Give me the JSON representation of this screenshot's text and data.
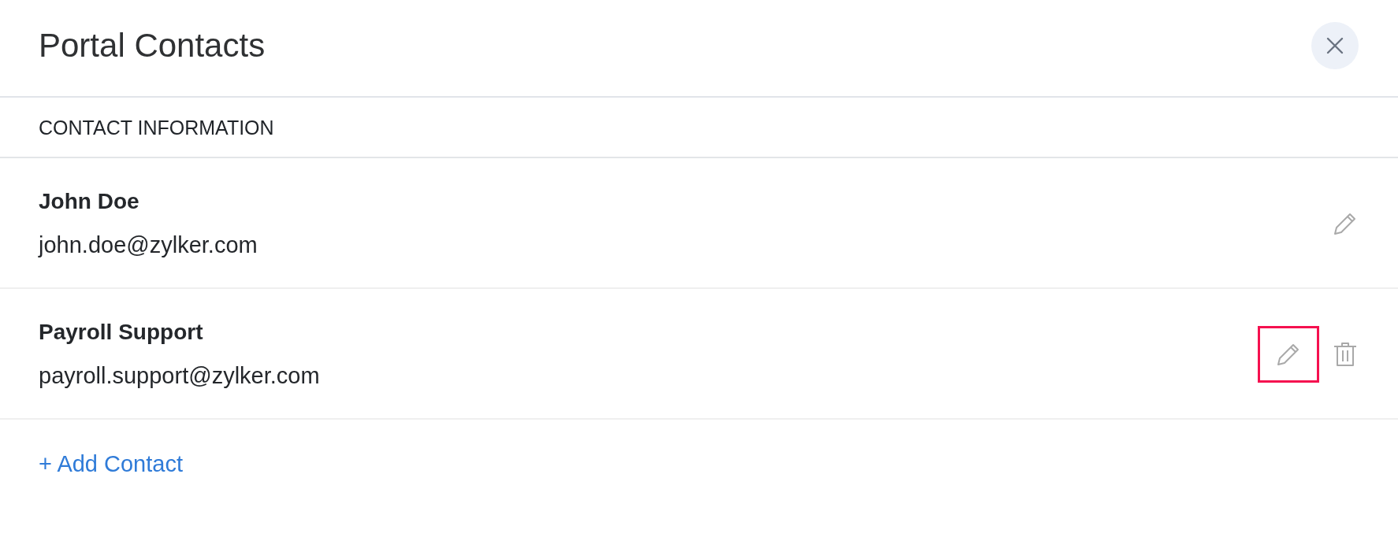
{
  "dialog": {
    "title": "Portal Contacts"
  },
  "section": {
    "heading": "CONTACT INFORMATION"
  },
  "contacts": [
    {
      "name": "John Doe",
      "email": "john.doe@zylker.com",
      "actions": [
        {
          "kind": "edit",
          "highlighted": false
        }
      ]
    },
    {
      "name": "Payroll Support",
      "email": "payroll.support@zylker.com",
      "actions": [
        {
          "kind": "edit",
          "highlighted": true
        },
        {
          "kind": "delete",
          "highlighted": false
        }
      ]
    }
  ],
  "add_link": {
    "label": "+ Add Contact"
  }
}
